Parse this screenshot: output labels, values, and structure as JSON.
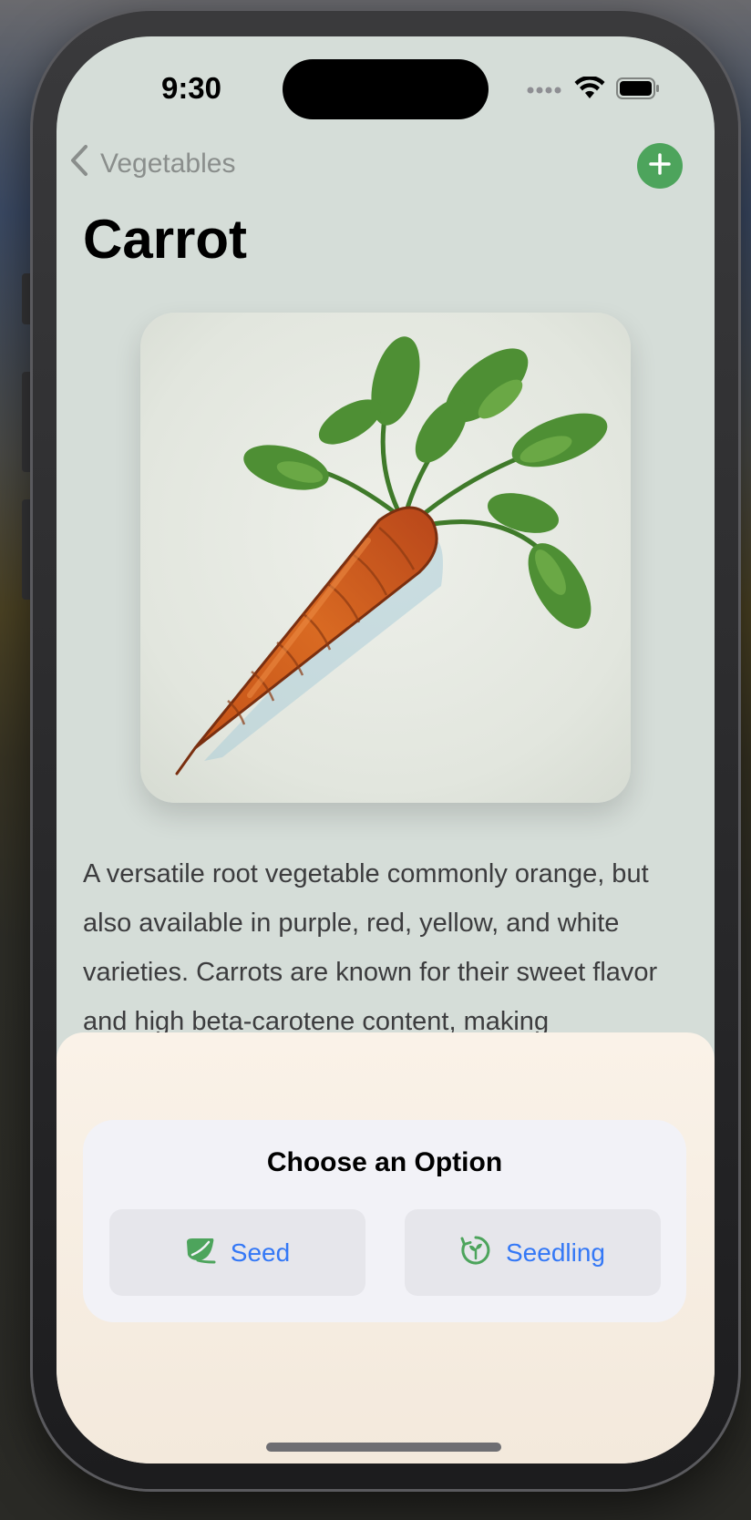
{
  "status_bar": {
    "time": "9:30"
  },
  "nav": {
    "back_label": "Vegetables"
  },
  "page": {
    "title": "Carrot",
    "description": "A versatile root vegetable commonly orange, but also available in purple, red, yellow, and white varieties. Carrots are known for their sweet flavor and high beta-carotene content, making"
  },
  "sheet": {
    "title": "Choose an Option",
    "options": [
      {
        "label": "Seed",
        "icon": "leaf-icon"
      },
      {
        "label": "Seedling",
        "icon": "sprout-cycle-icon"
      }
    ]
  },
  "colors": {
    "accent_green": "#4da45c",
    "link_blue": "#3478f6",
    "sheet_background": "#faf2e8"
  }
}
